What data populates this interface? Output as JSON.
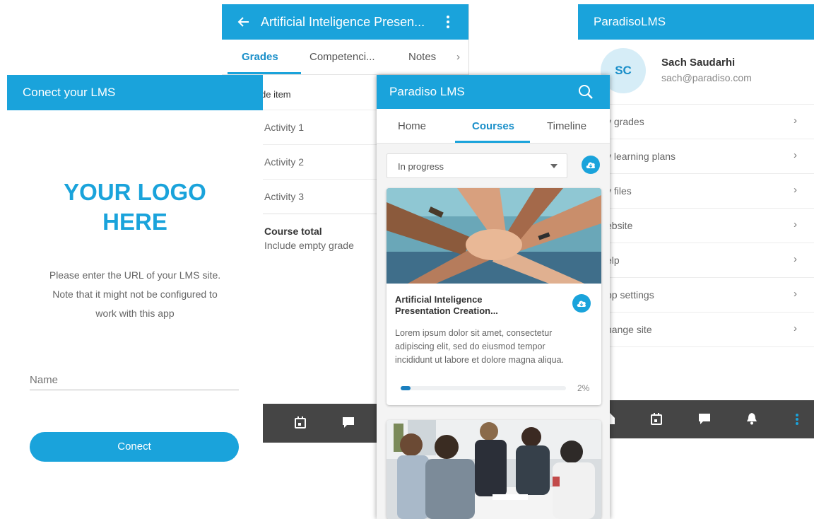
{
  "grades_screen": {
    "title": "Artificial Inteligence Presen...",
    "tabs": [
      "Grades",
      "Competenci...",
      "Notes"
    ],
    "column_header": "de item",
    "items": [
      "Activity 1",
      "Activity 2",
      "Activity 3"
    ],
    "course_total_label": "Course total",
    "course_total_sub": "Include empty grade"
  },
  "connect_screen": {
    "title": "Conect your LMS",
    "logo_line1": "YOUR LOGO",
    "logo_line2": "HERE",
    "desc_line1": "Please enter the URL of your LMS site.",
    "desc_line2": "Note that it might not be configured to",
    "desc_line3": "work with this app",
    "name_placeholder": "Name",
    "connect_button": "Conect"
  },
  "menu_screen": {
    "title": "ParadisoLMS",
    "avatar_initials": "SC",
    "user_name": "Sach Saudarhi",
    "user_email": "sach@paradiso.com",
    "items": [
      "y grades",
      "y learning plans",
      "y files",
      "ebsite",
      "elp",
      "pp settings",
      "hange site"
    ]
  },
  "courses_screen": {
    "title": "Paradiso LMS",
    "tabs": [
      "Home",
      "Courses",
      "Timeline"
    ],
    "filter_value": "In progress",
    "course_title_line1": "Artificial Inteligence",
    "course_title_line2": "Presentation Creation...",
    "course_desc_line1": "Lorem ipsum dolor sit amet, consectetur",
    "course_desc_line2": "adipiscing elit, sed do eiusmod tempor",
    "course_desc_line3": "incididunt ut labore et dolore magna aliqua.",
    "progress_label": "2%",
    "progress": 0.02
  },
  "colors": {
    "accent": "#1aa3db",
    "bottom_bar": "#454545"
  }
}
